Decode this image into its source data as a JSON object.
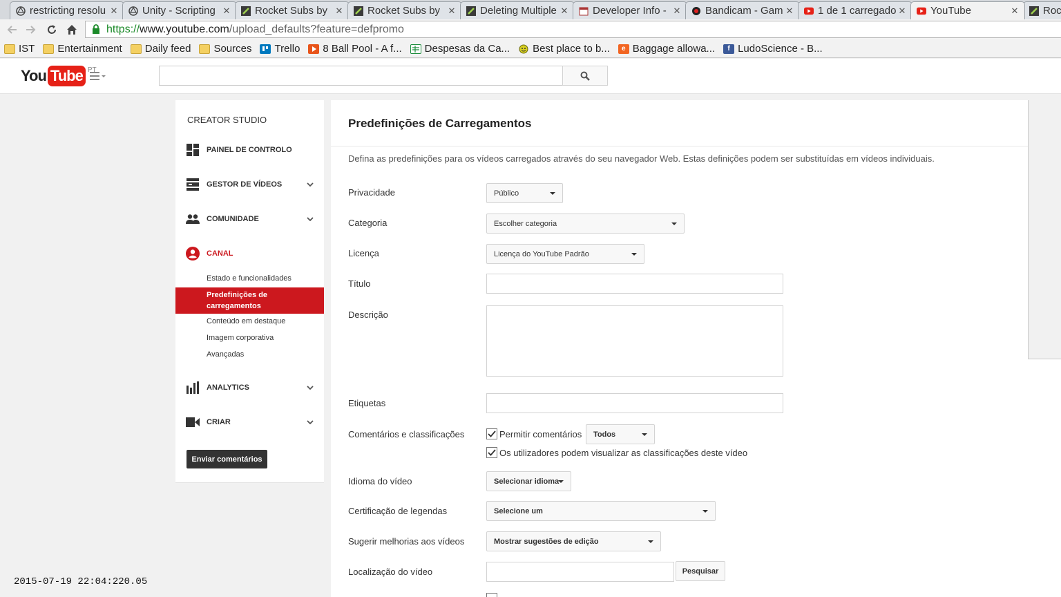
{
  "browser": {
    "tabs": [
      {
        "title": "restricting resolu",
        "favicon": "unity-icon"
      },
      {
        "title": "Unity - Scripting",
        "favicon": "unity-icon"
      },
      {
        "title": "Rocket Subs by",
        "favicon": "rocket-icon"
      },
      {
        "title": "Rocket Subs by",
        "favicon": "rocket-icon"
      },
      {
        "title": "Deleting Multiple",
        "favicon": "rocket-icon"
      },
      {
        "title": "Developer Info -",
        "favicon": "calendar-icon"
      },
      {
        "title": "Bandicam - Gam",
        "favicon": "bandicam-icon"
      },
      {
        "title": "1 de 1 carregado",
        "favicon": "youtube-icon"
      },
      {
        "title": "YouTube",
        "favicon": "youtube-icon"
      },
      {
        "title": "Roc",
        "favicon": "rocket-icon"
      }
    ],
    "url": {
      "scheme": "https://",
      "host": "www.youtube.com",
      "path": "/upload_defaults?feature=defpromo"
    },
    "bookmarks": [
      {
        "label": "IST",
        "icon": "folder-icon"
      },
      {
        "label": "Entertainment",
        "icon": "folder-icon"
      },
      {
        "label": "Daily feed",
        "icon": "folder-icon"
      },
      {
        "label": "Sources",
        "icon": "folder-icon"
      },
      {
        "label": "Trello",
        "icon": "trello-icon"
      },
      {
        "label": "8 Ball Pool - A f...",
        "icon": "play-icon"
      },
      {
        "label": "Despesas da Ca...",
        "icon": "sheets-icon"
      },
      {
        "label": "Best place to b...",
        "icon": "smiley-icon"
      },
      {
        "label": "Baggage allowa...",
        "icon": "e-icon"
      },
      {
        "label": "LudoScience - B...",
        "icon": "facebook-icon"
      }
    ]
  },
  "header": {
    "logo_you": "You",
    "logo_tube": "Tube",
    "country_code": "PT",
    "search_placeholder": ""
  },
  "sidebar": {
    "title": "CREATOR STUDIO",
    "items": [
      {
        "label": "PAINEL DE CONTROLO",
        "icon": "dashboard-icon"
      },
      {
        "label": "GESTOR DE VÍDEOS",
        "icon": "video-manager-icon"
      },
      {
        "label": "COMUNIDADE",
        "icon": "community-icon"
      },
      {
        "label": "CANAL",
        "icon": "channel-icon"
      },
      {
        "label": "ANALYTICS",
        "icon": "analytics-icon"
      },
      {
        "label": "CRIAR",
        "icon": "create-icon"
      }
    ],
    "channel_subitems": [
      "Estado e funcionalidades",
      "Predefinições de carregamentos",
      "Conteúdo em destaque",
      "Imagem corporativa",
      "Avançadas"
    ],
    "feedback_button": "Enviar comentários"
  },
  "main": {
    "title": "Predefinições de Carregamentos",
    "intro": "Defina as predefinições para os vídeos carregados através do seu navegador Web. Estas definições podem ser substituídas em vídeos individuais.",
    "fields": {
      "privacy": {
        "label": "Privacidade",
        "value": "Público"
      },
      "category": {
        "label": "Categoria",
        "value": "Escolher categoria"
      },
      "license": {
        "label": "Licença",
        "value": "Licença do YouTube Padrão"
      },
      "title": {
        "label": "Título",
        "value": ""
      },
      "description": {
        "label": "Descrição",
        "value": ""
      },
      "tags": {
        "label": "Etiquetas",
        "value": ""
      },
      "comments": {
        "label": "Comentários e classificações",
        "allow_comments": "Permitir comentários",
        "allow_comments_checked": true,
        "comments_scope": "Todos",
        "show_ratings": "Os utilizadores podem visualizar as classificações deste vídeo",
        "show_ratings_checked": true
      },
      "language": {
        "label": "Idioma do vídeo",
        "value": "Selecionar idioma"
      },
      "caption_cert": {
        "label": "Certificação de legendas",
        "value": "Selecione um"
      },
      "suggest": {
        "label": "Sugerir melhorias aos vídeos",
        "value": "Mostrar sugestões de edição"
      },
      "location": {
        "label": "Localização do vídeo",
        "value": "",
        "search_button": "Pesquisar"
      }
    }
  },
  "overlay": {
    "timestamp": "2015-07-19 22:04:220.05"
  },
  "colors": {
    "youtube_red": "#cc181e",
    "logo_red": "#e62117",
    "https_green": "#1b8a29"
  }
}
